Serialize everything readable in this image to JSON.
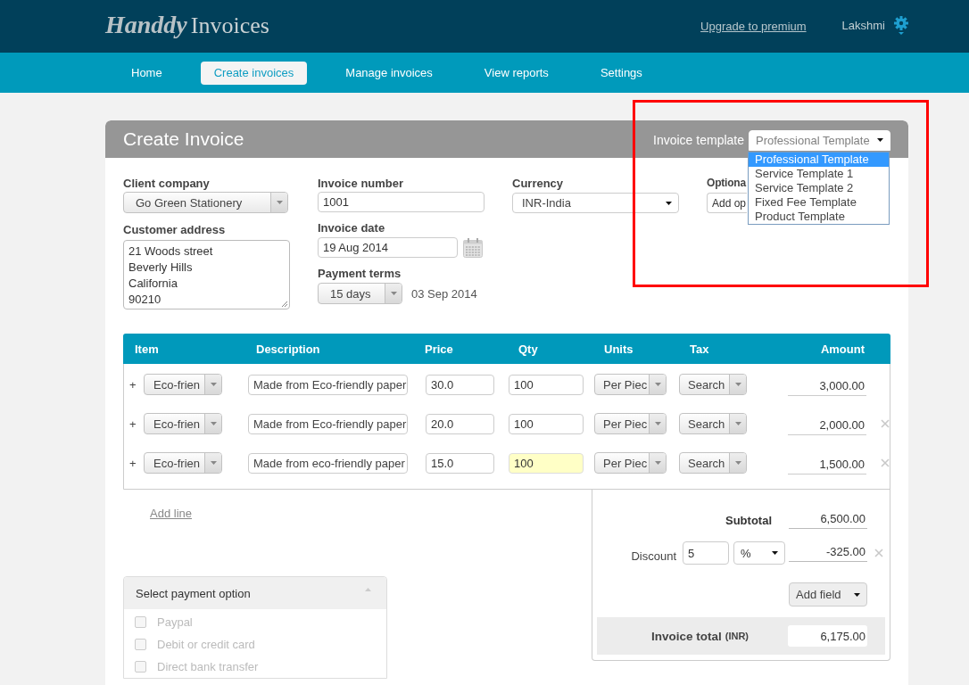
{
  "app": {
    "logo_script": "Handdy",
    "logo_text": "Invoices",
    "upgrade_link": "Upgrade to premium",
    "user_name": "Lakshmi"
  },
  "nav": [
    {
      "label": "Home",
      "selected": false
    },
    {
      "label": "Create invoices",
      "selected": true
    },
    {
      "label": "Manage invoices",
      "selected": false
    },
    {
      "label": "View reports",
      "selected": false
    },
    {
      "label": "Settings",
      "selected": false
    }
  ],
  "page_title": "Create Invoice",
  "template": {
    "label": "Invoice template",
    "value": "Professional Template",
    "expanded": true,
    "options": [
      {
        "label": "Professional Template",
        "selected": true
      },
      {
        "label": "Service Template 1",
        "selected": false
      },
      {
        "label": "Service Template 2",
        "selected": false
      },
      {
        "label": "Fixed Fee Template",
        "selected": false
      },
      {
        "label": "Product Template",
        "selected": false
      }
    ]
  },
  "form": {
    "client_company": {
      "label": "Client company",
      "value": "Go Green Stationery"
    },
    "customer_address": {
      "label": "Customer address",
      "lines": [
        "21 Woods street",
        "Beverly Hills",
        "California",
        "90210"
      ]
    },
    "invoice_number": {
      "label": "Invoice number",
      "value": "1001"
    },
    "invoice_date": {
      "label": "Invoice date",
      "value": "19 Aug 2014"
    },
    "payment_terms": {
      "label": "Payment terms",
      "value": "15 days",
      "due_date": "03 Sep 2014"
    },
    "currency": {
      "label": "Currency",
      "value": "INR-India"
    },
    "optional": {
      "label": "Optiona",
      "value": "Add op"
    }
  },
  "items": {
    "columns": [
      "Item",
      "Description",
      "Price",
      "Qty",
      "Units",
      "Tax",
      "Amount"
    ],
    "rows": [
      {
        "add_symbol": "+",
        "item": "Eco-frien",
        "description": "Made from Eco-friendly paper",
        "price": "30.0",
        "qty": "100",
        "qty_focused": false,
        "units": "Per Piec",
        "tax": "Search",
        "amount": "3,000.00",
        "removable": false
      },
      {
        "add_symbol": "+",
        "item": "Eco-frien",
        "description": "Made from Eco-friendly paper",
        "price": "20.0",
        "qty": "100",
        "qty_focused": false,
        "units": "Per Piec",
        "tax": "Search",
        "amount": "2,000.00",
        "removable": true
      },
      {
        "add_symbol": "+",
        "item": "Eco-frien",
        "description": "Made from eco-friendly paper",
        "price": "15.0",
        "qty": "100",
        "qty_focused": true,
        "units": "Per Piec",
        "tax": "Search",
        "amount": "1,500.00",
        "removable": true
      }
    ]
  },
  "add_line": "Add line",
  "payment": {
    "title": "Select payment option",
    "expanded": true,
    "options": [
      {
        "label": "Paypal",
        "checked": false,
        "disabled": true
      },
      {
        "label": "Debit or credit card",
        "checked": false,
        "disabled": true
      },
      {
        "label": "Direct bank transfer",
        "checked": false,
        "disabled": true
      }
    ]
  },
  "totals": {
    "subtotal_label": "Subtotal",
    "subtotal": "6,500.00",
    "discount_label": "Discount",
    "discount_value": "5",
    "discount_unit": "%",
    "discount_amount": "-325.00",
    "add_field": "Add field",
    "total_label": "Invoice total",
    "total_currency": "(INR)",
    "total": "6,175.00"
  }
}
